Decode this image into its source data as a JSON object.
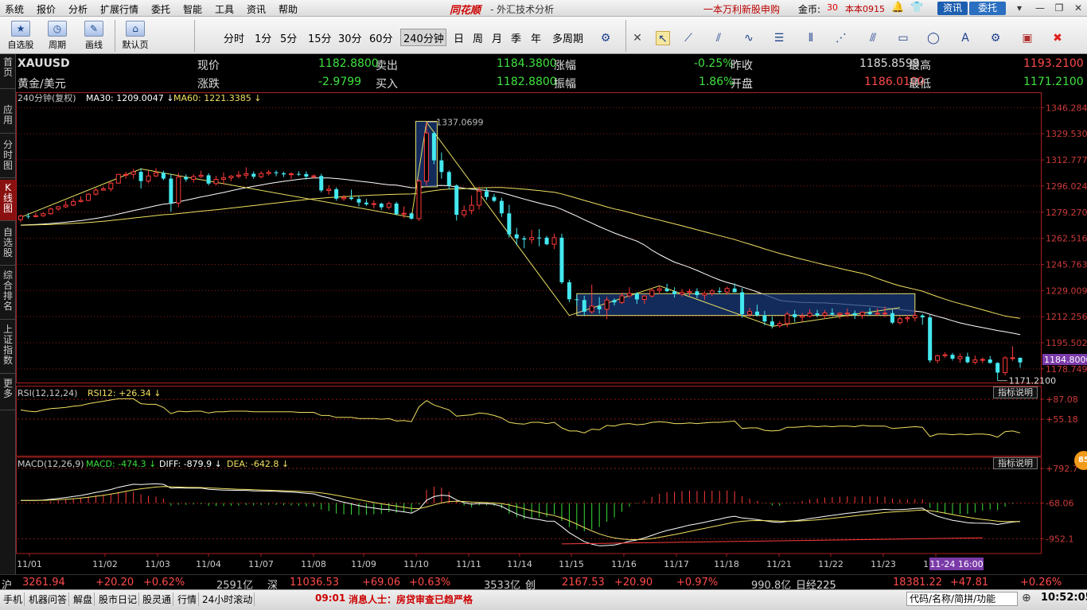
{
  "menu": {
    "items": [
      "系统",
      "报价",
      "分析",
      "扩展行情",
      "委托",
      "智能",
      "工具",
      "资讯",
      "帮助"
    ],
    "brand": "同花顺",
    "brand_sub": "- 外汇技术分析",
    "promo": "一本万利新股申购",
    "coins_label": "金币:",
    "coins_value": "30",
    "user": "本本0915",
    "btn_news": "资讯",
    "btn_trade": "委托"
  },
  "toolbar": {
    "big_buttons": [
      {
        "icon": "★",
        "label": "自选股"
      },
      {
        "icon": "◷",
        "label": "周期"
      },
      {
        "icon": "✎",
        "label": "画线"
      },
      {
        "icon": "⌂",
        "label": "默认页"
      }
    ],
    "periods": [
      "分时",
      "1分",
      "5分",
      "15分",
      "30分",
      "60分",
      "240分钟",
      "日",
      "周",
      "月",
      "季",
      "年",
      "多周期"
    ],
    "active_period": "240分钟"
  },
  "left_tabs": [
    {
      "label": "首页",
      "active": false
    },
    {
      "label": "应用",
      "active": false
    },
    {
      "label": "分时图",
      "active": false
    },
    {
      "label": "K线图",
      "active": true
    },
    {
      "label": "自选股",
      "active": false
    },
    {
      "label": "综合排名",
      "active": false
    },
    {
      "label": "上证指数",
      "active": false
    },
    {
      "label": "更多",
      "active": false
    }
  ],
  "quote": {
    "symbol": "XAUUSD",
    "name": "黄金/美元",
    "labels": {
      "price": "现价",
      "change": "涨跌",
      "ask": "卖出",
      "bid": "买入",
      "pct": "涨幅",
      "amplitude": "振幅",
      "prev_close": "昨收",
      "open": "开盘",
      "high": "最高",
      "low": "最低"
    },
    "price": "1182.8800",
    "change": "-2.9799",
    "ask": "1184.3800",
    "bid": "1182.8800",
    "pct": "-0.25%",
    "amplitude": "1.86%",
    "prev_close": "1185.8599",
    "open": "1186.0100",
    "high": "1193.2100",
    "low": "1171.2100"
  },
  "chart_data": {
    "type": "candlestick",
    "period_label": "240分钟(复权)",
    "ma_labels": {
      "ma30": "MA30: 1209.0047",
      "ma60": "MA60: 1221.3385"
    },
    "colors": {
      "up": "#ff3a3a",
      "down": "#44e8f0",
      "ma30": "#ffffff",
      "ma60": "#f0e060",
      "grid": "#8a1a1a",
      "axis": "#aa2020"
    },
    "y_ticks": [
      "1346.2843",
      "1329.5301",
      "1312.7773",
      "1296.0245",
      "1279.2703",
      "1262.5161",
      "1245.7633",
      "1229.0097",
      "1212.2569",
      "1195.5027",
      "1178.7499"
    ],
    "y_range": [
      1170.0,
      1348.0
    ],
    "x_ticks": [
      "11/01",
      "11/02",
      "11/03",
      "11/04",
      "11/07",
      "11/08",
      "11/09",
      "11/10",
      "11/11",
      "11/14",
      "11/15",
      "11/16",
      "11/17",
      "11/18",
      "11/21",
      "11/22",
      "11/23",
      "11/24"
    ],
    "candles": [
      [
        1274.5,
        1277.8,
        1272.8,
        1276.8
      ],
      [
        1276.8,
        1278.7,
        1275.1,
        1276.4
      ],
      [
        1276.4,
        1279.0,
        1275.9,
        1277.0
      ],
      [
        1277.0,
        1279.1,
        1276.2,
        1278.3
      ],
      [
        1278.3,
        1282.3,
        1277.6,
        1281.3
      ],
      [
        1281.3,
        1283.2,
        1280.2,
        1282.7
      ],
      [
        1282.7,
        1286.5,
        1281.9,
        1283.8
      ],
      [
        1283.8,
        1288.0,
        1283.1,
        1286.1
      ],
      [
        1286.1,
        1289.4,
        1285.5,
        1286.8
      ],
      [
        1286.8,
        1291.5,
        1286.3,
        1290.8
      ],
      [
        1290.8,
        1294.7,
        1289.9,
        1293.4
      ],
      [
        1293.4,
        1295.7,
        1293.0,
        1294.2
      ],
      [
        1294.2,
        1298.7,
        1292.5,
        1297.9
      ],
      [
        1297.9,
        1303.7,
        1297.6,
        1303.5
      ],
      [
        1303.5,
        1305.1,
        1300.7,
        1303.5
      ],
      [
        1303.5,
        1307.0,
        1300.6,
        1305.1
      ],
      [
        1305.1,
        1307.5,
        1294.4,
        1299.2
      ],
      [
        1299.2,
        1305.8,
        1297.8,
        1302.5
      ],
      [
        1302.5,
        1307.5,
        1301.8,
        1304.5
      ],
      [
        1304.5,
        1305.9,
        1299.8,
        1300.8
      ],
      [
        1300.8,
        1303.8,
        1279.6,
        1285.1
      ],
      [
        1285.1,
        1304.4,
        1282.5,
        1301.8
      ],
      [
        1301.8,
        1303.5,
        1298.8,
        1300.3
      ],
      [
        1300.3,
        1303.6,
        1298.1,
        1302.1
      ],
      [
        1302.1,
        1305.8,
        1301.2,
        1302.9
      ],
      [
        1302.9,
        1304.2,
        1296.5,
        1297.6
      ],
      [
        1297.6,
        1302.5,
        1296.5,
        1300.3
      ],
      [
        1300.3,
        1304.8,
        1297.1,
        1301.3
      ],
      [
        1301.3,
        1303.0,
        1299.2,
        1302.3
      ],
      [
        1302.3,
        1305.7,
        1300.9,
        1303.0
      ],
      [
        1303.0,
        1308.0,
        1300.7,
        1303.9
      ],
      [
        1303.9,
        1305.4,
        1300.7,
        1302.0
      ],
      [
        1302.0,
        1305.5,
        1301.0,
        1304.0
      ],
      [
        1304.0,
        1306.4,
        1302.8,
        1304.8
      ],
      [
        1304.8,
        1306.0,
        1302.3,
        1304.2
      ],
      [
        1304.2,
        1305.2,
        1301.8,
        1303.5
      ],
      [
        1303.5,
        1304.8,
        1300.5,
        1303.8
      ],
      [
        1303.8,
        1305.5,
        1302.4,
        1303.7
      ],
      [
        1303.7,
        1305.4,
        1300.1,
        1302.1
      ],
      [
        1302.1,
        1303.5,
        1300.7,
        1302.5
      ],
      [
        1302.5,
        1303.9,
        1291.9,
        1293.2
      ],
      [
        1293.2,
        1296.4,
        1290.6,
        1294.0
      ],
      [
        1294.0,
        1295.1,
        1286.6,
        1287.9
      ],
      [
        1287.9,
        1290.4,
        1286.5,
        1288.7
      ],
      [
        1288.7,
        1293.7,
        1286.9,
        1287.7
      ],
      [
        1287.7,
        1289.8,
        1283.0,
        1285.4
      ],
      [
        1285.4,
        1287.7,
        1283.3,
        1284.3
      ],
      [
        1284.3,
        1286.8,
        1281.6,
        1284.7
      ],
      [
        1284.7,
        1285.4,
        1280.8,
        1282.4
      ],
      [
        1282.4,
        1286.0,
        1281.1,
        1284.8
      ],
      [
        1284.8,
        1285.9,
        1277.2,
        1278.0
      ],
      [
        1278.0,
        1283.0,
        1275.4,
        1278.5
      ],
      [
        1278.5,
        1279.0,
        1274.4,
        1275.1
      ],
      [
        1275.1,
        1300.5,
        1273.7,
        1299.2
      ],
      [
        1299.2,
        1337.1,
        1296.4,
        1330.0
      ],
      [
        1330.0,
        1331.0,
        1310.0,
        1312.5
      ],
      [
        1312.5,
        1317.6,
        1300.7,
        1305.0
      ],
      [
        1305.0,
        1306.0,
        1294.1,
        1296.4
      ],
      [
        1296.4,
        1297.1,
        1273.9,
        1277.6
      ],
      [
        1277.6,
        1283.6,
        1275.8,
        1280.3
      ],
      [
        1280.3,
        1290.0,
        1277.9,
        1283.7
      ],
      [
        1283.7,
        1295.4,
        1281.0,
        1292.7
      ],
      [
        1292.7,
        1295.0,
        1287.0,
        1289.0
      ],
      [
        1289.0,
        1291.0,
        1285.6,
        1286.5
      ],
      [
        1286.5,
        1288.5,
        1276.2,
        1278.5
      ],
      [
        1278.5,
        1284.0,
        1262.9,
        1265.0
      ],
      [
        1265.0,
        1269.2,
        1258.0,
        1262.5
      ],
      [
        1262.5,
        1264.0,
        1256.1,
        1261.7
      ],
      [
        1261.7,
        1268.0,
        1259.1,
        1263.0
      ],
      [
        1263.0,
        1268.4,
        1257.4,
        1262.9
      ],
      [
        1262.9,
        1264.0,
        1258.0,
        1258.7
      ],
      [
        1258.7,
        1265.5,
        1255.6,
        1262.9
      ],
      [
        1262.9,
        1265.4,
        1233.2,
        1234.3
      ],
      [
        1234.3,
        1236.0,
        1221.6,
        1223.4
      ],
      [
        1223.4,
        1226.2,
        1219.2,
        1222.9
      ],
      [
        1222.9,
        1225.7,
        1213.0,
        1215.4
      ],
      [
        1215.4,
        1232.8,
        1214.1,
        1219.0
      ],
      [
        1219.0,
        1224.8,
        1214.1,
        1217.0
      ],
      [
        1217.0,
        1225.0,
        1210.6,
        1222.9
      ],
      [
        1222.9,
        1224.0,
        1219.4,
        1221.4
      ],
      [
        1221.4,
        1227.6,
        1220.3,
        1225.6
      ],
      [
        1225.6,
        1231.1,
        1224.3,
        1227.1
      ],
      [
        1227.1,
        1228.0,
        1220.4,
        1223.3
      ],
      [
        1223.3,
        1226.1,
        1220.3,
        1225.5
      ],
      [
        1225.5,
        1230.6,
        1224.5,
        1229.1
      ],
      [
        1229.1,
        1232.0,
        1226.8,
        1230.1
      ],
      [
        1230.1,
        1233.4,
        1228.0,
        1228.6
      ],
      [
        1228.6,
        1231.1,
        1224.5,
        1226.7
      ],
      [
        1226.7,
        1230.0,
        1225.2,
        1227.8
      ],
      [
        1227.8,
        1230.2,
        1225.6,
        1228.5
      ],
      [
        1228.5,
        1230.4,
        1224.1,
        1226.1
      ],
      [
        1226.1,
        1228.6,
        1223.0,
        1227.2
      ],
      [
        1227.2,
        1230.1,
        1225.5,
        1228.7
      ],
      [
        1228.7,
        1231.0,
        1226.9,
        1228.1
      ],
      [
        1228.1,
        1231.6,
        1226.2,
        1230.3
      ],
      [
        1230.3,
        1233.6,
        1227.9,
        1227.9
      ],
      [
        1227.9,
        1230.6,
        1211.6,
        1213.8
      ],
      [
        1213.8,
        1217.8,
        1212.3,
        1215.5
      ],
      [
        1215.5,
        1219.9,
        1212.3,
        1213.1
      ],
      [
        1213.1,
        1216.0,
        1206.6,
        1209.2
      ],
      [
        1209.2,
        1212.5,
        1204.7,
        1206.4
      ],
      [
        1206.4,
        1209.3,
        1205.1,
        1207.8
      ],
      [
        1207.8,
        1215.5,
        1205.5,
        1213.9
      ],
      [
        1213.9,
        1216.5,
        1208.8,
        1211.9
      ],
      [
        1211.9,
        1214.6,
        1209.1,
        1212.7
      ],
      [
        1212.7,
        1217.0,
        1211.6,
        1214.4
      ],
      [
        1214.4,
        1216.6,
        1211.8,
        1213.2
      ],
      [
        1213.2,
        1216.5,
        1210.8,
        1214.6
      ],
      [
        1214.6,
        1217.5,
        1212.7,
        1213.6
      ],
      [
        1213.6,
        1215.1,
        1210.9,
        1214.4
      ],
      [
        1214.4,
        1217.5,
        1211.9,
        1214.5
      ],
      [
        1214.5,
        1216.2,
        1210.7,
        1213.2
      ],
      [
        1213.2,
        1215.6,
        1210.9,
        1215.1
      ],
      [
        1215.1,
        1217.8,
        1212.9,
        1213.9
      ],
      [
        1213.9,
        1217.6,
        1212.8,
        1214.5
      ],
      [
        1214.5,
        1218.7,
        1211.9,
        1214.5
      ],
      [
        1214.5,
        1216.9,
        1207.5,
        1208.4
      ],
      [
        1208.4,
        1212.5,
        1207.2,
        1210.9
      ],
      [
        1210.9,
        1213.4,
        1208.7,
        1211.5
      ],
      [
        1211.5,
        1215.8,
        1209.3,
        1213.0
      ],
      [
        1213.0,
        1214.0,
        1207.1,
        1211.8
      ],
      [
        1211.8,
        1213.3,
        1182.8,
        1184.2
      ],
      [
        1184.2,
        1187.9,
        1182.3,
        1187.2
      ],
      [
        1187.2,
        1189.5,
        1186.0,
        1187.8
      ],
      [
        1187.8,
        1189.0,
        1184.1,
        1185.3
      ],
      [
        1185.3,
        1188.6,
        1182.7,
        1186.6
      ],
      [
        1186.6,
        1189.1,
        1182.3,
        1183.0
      ],
      [
        1183.0,
        1187.3,
        1181.6,
        1184.5
      ],
      [
        1184.5,
        1186.1,
        1182.3,
        1184.8
      ],
      [
        1184.8,
        1187.0,
        1182.1,
        1182.6
      ],
      [
        1182.6,
        1183.0,
        1171.2,
        1176.4
      ],
      [
        1176.4,
        1186.9,
        1174.6,
        1185.8
      ],
      [
        1185.8,
        1193.2,
        1183.9,
        1185.9
      ],
      [
        1185.9,
        1186.0,
        1179.5,
        1182.9
      ]
    ],
    "max_label": "1337.0699",
    "min_label": "1171.2100",
    "last_price_tag": "1184.8000",
    "rsi": {
      "label": "RSI(12,12,24)",
      "value_label": "RSI12: +26.34",
      "y_ticks": [
        "+87.08",
        "+55.18"
      ],
      "y_range": [
        0,
        100
      ],
      "values": [
        70,
        68,
        67,
        70,
        72,
        73,
        74,
        76,
        77,
        80,
        82,
        84,
        86,
        88,
        88,
        88,
        80,
        79,
        79,
        74,
        64,
        68,
        67,
        68,
        68,
        65,
        67,
        67,
        68,
        68,
        68,
        67,
        67,
        67,
        67,
        67,
        67,
        66,
        66,
        66,
        61,
        61,
        58,
        58,
        58,
        56,
        56,
        56,
        55,
        56,
        52,
        53,
        51,
        75,
        85,
        78,
        74,
        70,
        60,
        61,
        62,
        65,
        64,
        61,
        57,
        50,
        48,
        47,
        50,
        50,
        48,
        50,
        41,
        36,
        36,
        33,
        39,
        38,
        45,
        44,
        47,
        48,
        46,
        47,
        50,
        51,
        50,
        48,
        48,
        49,
        48,
        49,
        50,
        50,
        51,
        52,
        40,
        41,
        41,
        37,
        36,
        37,
        42,
        42,
        43,
        44,
        43,
        44,
        43,
        44,
        44,
        43,
        45,
        44,
        44,
        44,
        40,
        41,
        42,
        43,
        42,
        27,
        31,
        31,
        30,
        31,
        30,
        31,
        31,
        30,
        26,
        35,
        36,
        33
      ],
      "btn": "指标说明"
    },
    "macd": {
      "label": "MACD(12,26,9)",
      "macd_label": "MACD: -474.3",
      "diff_label": "DIFF: -879.9",
      "dea_label": "DEA: -642.8",
      "y_ticks": [
        "+792.7",
        "-68.06",
        "-952.1"
      ],
      "y_range": [
        -1200,
        950
      ],
      "btn": "指标说明"
    },
    "crosshair_label": "11-24 16:00"
  },
  "status": {
    "sh_label": "沪",
    "sh_val": "3261.94",
    "sh_chg": "+20.20",
    "sh_pct": "+0.62%",
    "sh_amt": "2591亿",
    "sz_label": "深",
    "sz_val": "11036.53",
    "sz_chg": "+69.06",
    "sz_pct": "+0.63%",
    "sz_amt": "3533亿",
    "cy_label": "创",
    "cy_val": "2167.53",
    "cy_chg": "+20.90",
    "cy_pct": "+0.97%",
    "cy_amt": "990.8亿",
    "nk_label": "日经225",
    "nk_val": "18381.22",
    "nk_chg": "+47.81",
    "nk_pct": "+0.26%"
  },
  "bottom": {
    "items": [
      "手机",
      "机器问答",
      "解盘",
      "股市日记",
      "股灵通",
      "行情",
      "24小时滚动"
    ],
    "ticker_time": "09:01",
    "ticker_text": "消息人士：房贷审查已趋严格",
    "search_placeholder": "代码/名称/简拼/功能",
    "clock": "10:52:05"
  }
}
